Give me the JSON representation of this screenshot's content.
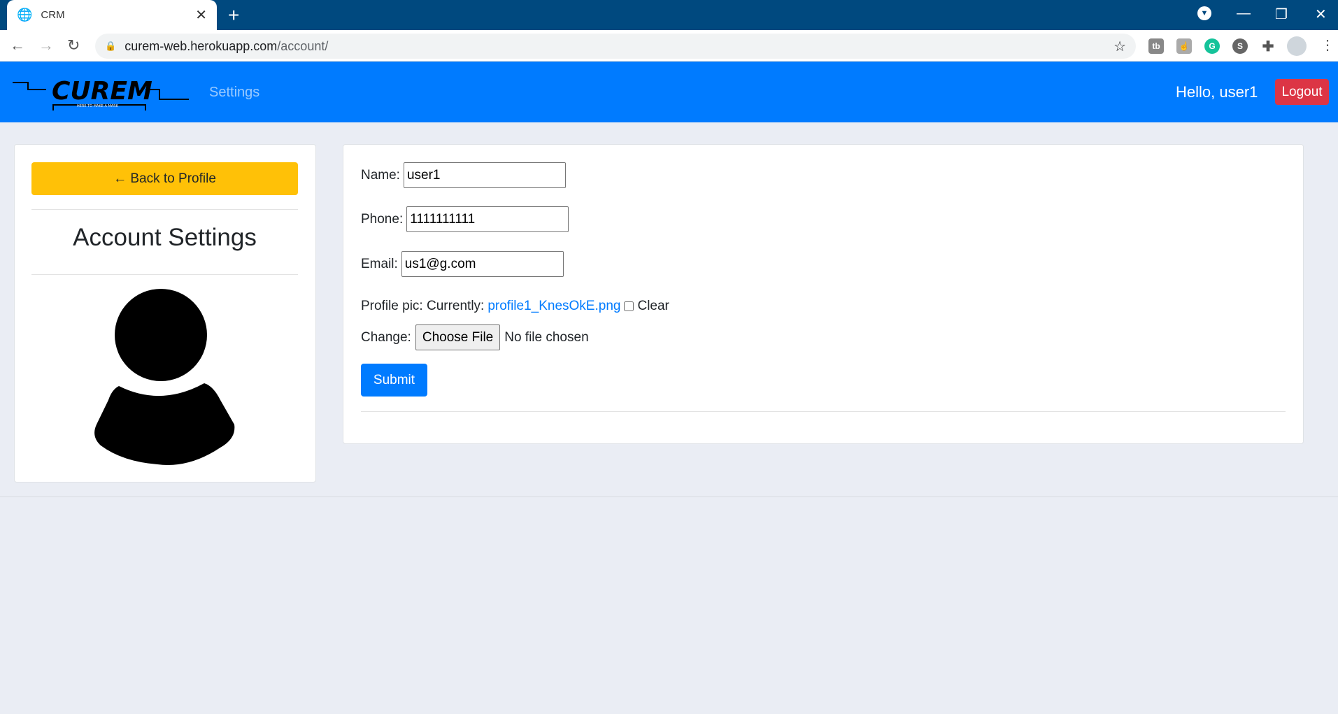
{
  "browser": {
    "tab_title": "CRM",
    "url_host": "curem-web.herokuapp.com",
    "url_path": "/account/",
    "extensions": [
      "tubebuddy-icon",
      "touch-icon",
      "grammarly-icon",
      "s-extension-icon",
      "puzzle-icon",
      "profile-avatar"
    ]
  },
  "navbar": {
    "logo_text": "CUREM",
    "logo_tagline": "HERE TO MAKE A MARK",
    "settings": "Settings",
    "greeting": "Hello, user1",
    "logout": "Logout",
    "color": "#007bff"
  },
  "sidebar": {
    "back": "← Back to Profile",
    "title": "Account Settings"
  },
  "form": {
    "name_label": "Name:",
    "name_value": "user1",
    "phone_label": "Phone:",
    "phone_value": "1111111111",
    "email_label": "Email:",
    "email_value": "us1@g.com",
    "pic_label": "Profile pic: Currently:",
    "pic_file": "profile1_KnesOkE.png",
    "clear_label": "Clear",
    "change_label": "Change:",
    "choose_file": "Choose File",
    "no_file": "No file chosen",
    "submit": "Submit"
  }
}
